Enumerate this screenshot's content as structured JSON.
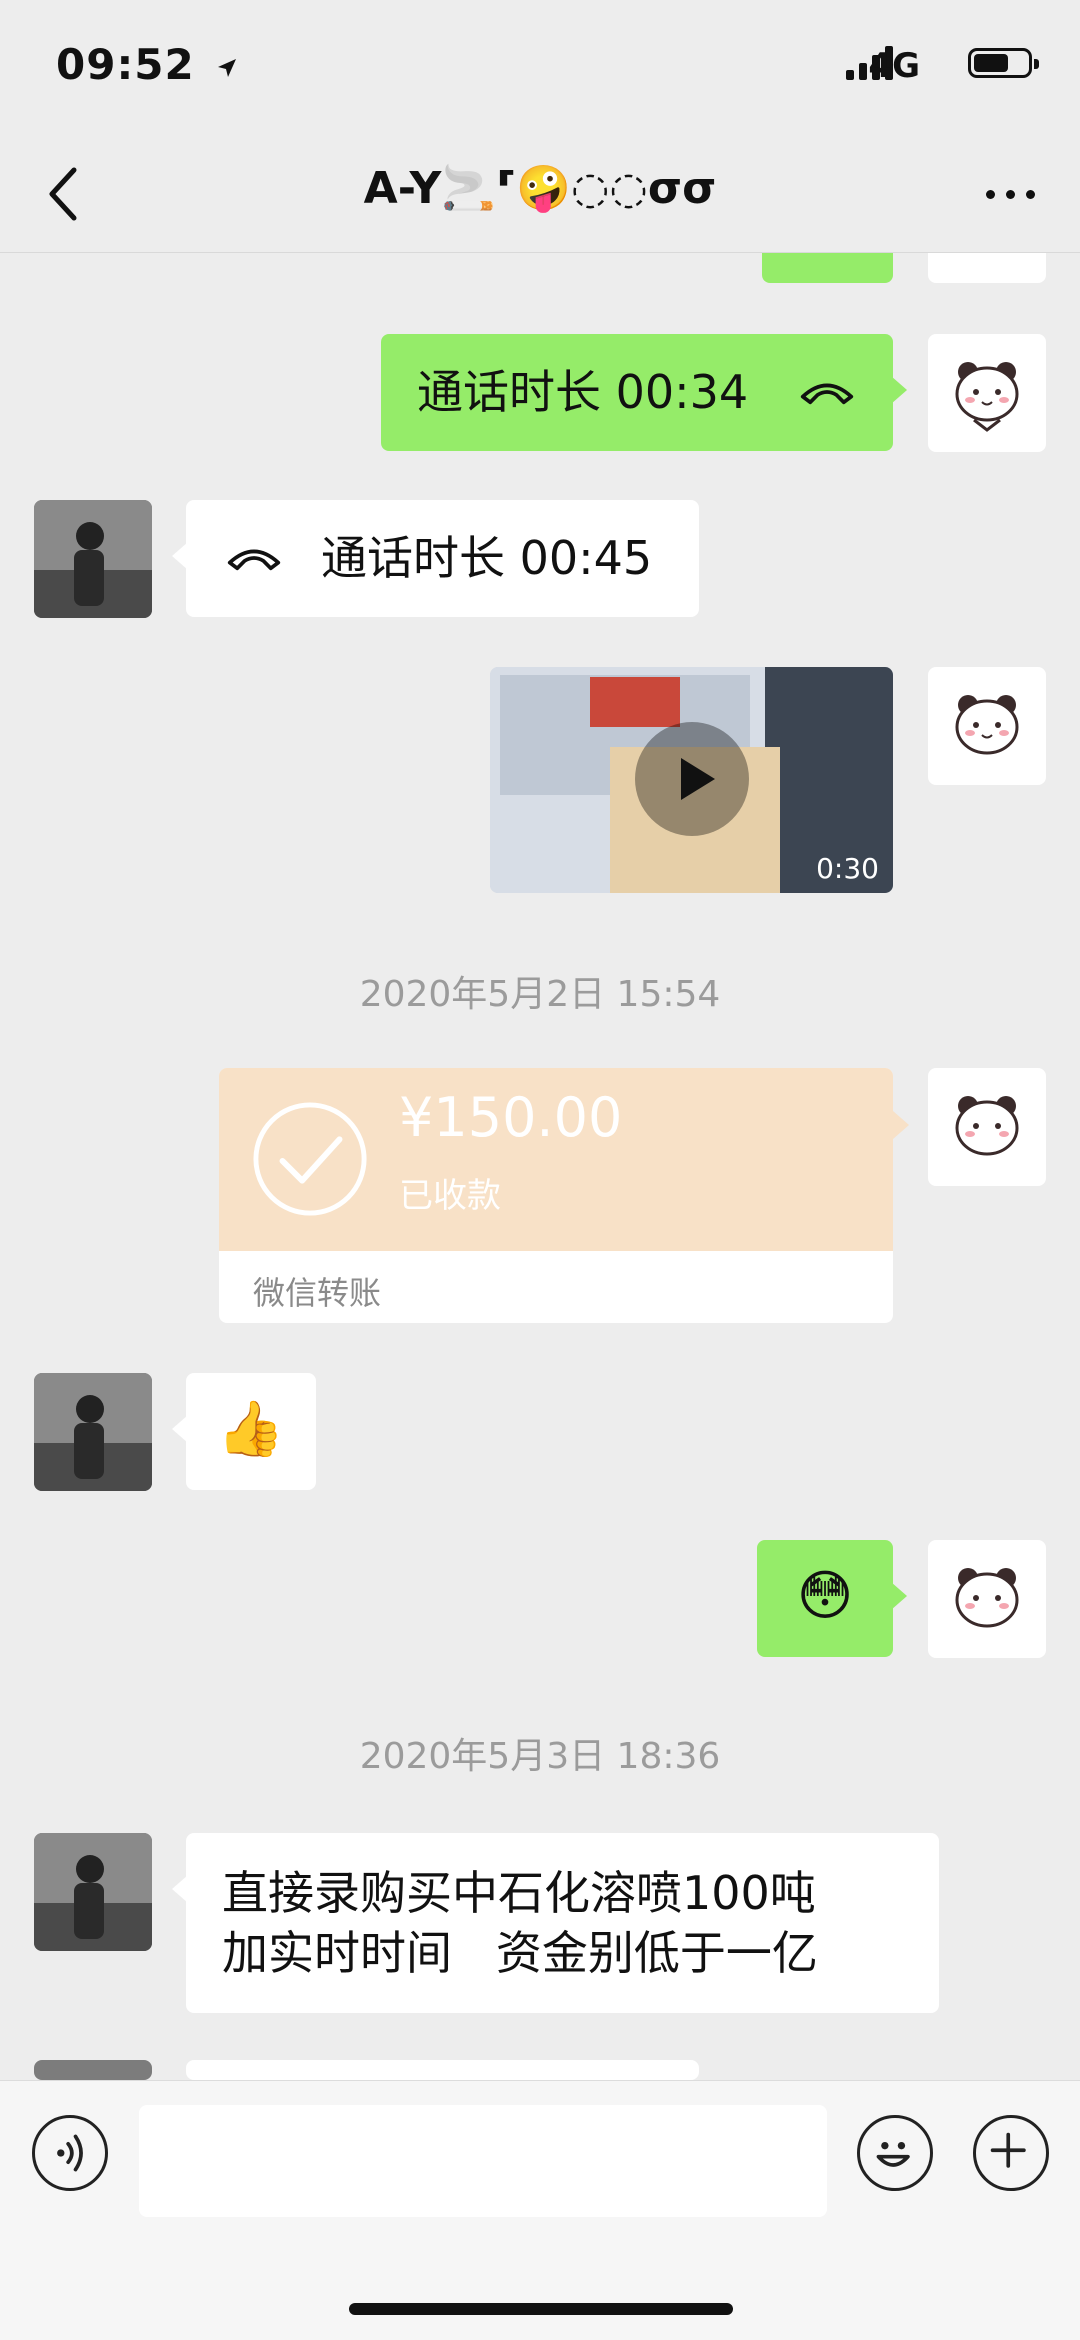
{
  "status": {
    "time": "09:52",
    "network": "4G"
  },
  "nav": {
    "title": "A-Y🚬⸢🤪◌◌σσ"
  },
  "messages": {
    "call_out": "通话时长 00:34",
    "call_in": "通话时长 00:45",
    "video_duration": "0:30",
    "stamp1": "2020年5月2日 15:54",
    "transfer_amount": "¥150.00",
    "transfer_status": "已收款",
    "transfer_footer": "微信转账",
    "reply_emoji": "👍",
    "my_emoji": "😳",
    "stamp2": "2020年5月3日 18:36",
    "text_line1": "直接录购买中石化溶喷100吨",
    "text_line2": "加实时时间   资金别低于一亿"
  },
  "colors": {
    "green_bubble": "#95ec69",
    "transfer_bg": "#f8e1c7",
    "background": "#ededed"
  }
}
